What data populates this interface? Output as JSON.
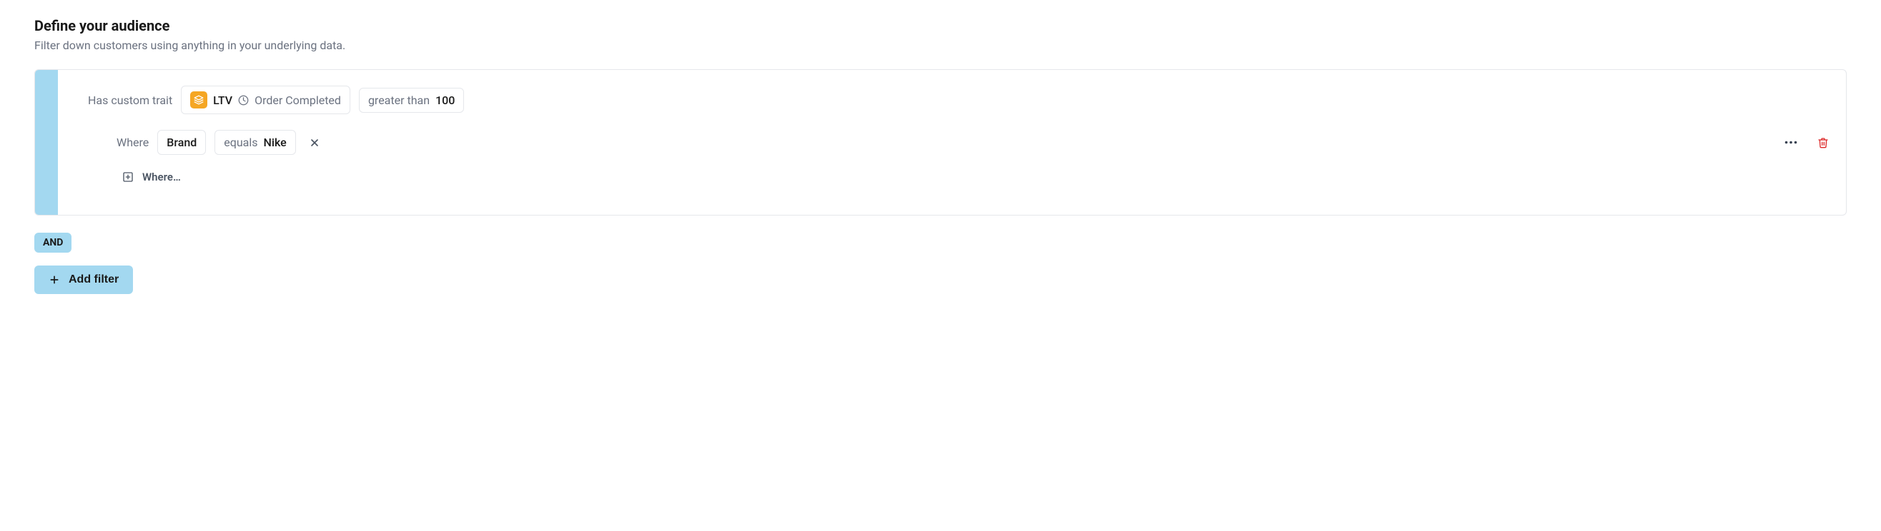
{
  "header": {
    "title": "Define your audience",
    "subtitle": "Filter down customers using anything in your underlying data."
  },
  "filter": {
    "trait_label": "Has custom trait",
    "trait_pill": {
      "name": "LTV",
      "event": "Order Completed"
    },
    "operator_pill": {
      "operator": "greater than",
      "value": "100"
    },
    "where": {
      "label": "Where",
      "property": "Brand",
      "operator": "equals",
      "value": "Nike"
    },
    "add_where_label": "Where…"
  },
  "logic": {
    "and_label": "AND"
  },
  "add_filter_label": "Add filter"
}
